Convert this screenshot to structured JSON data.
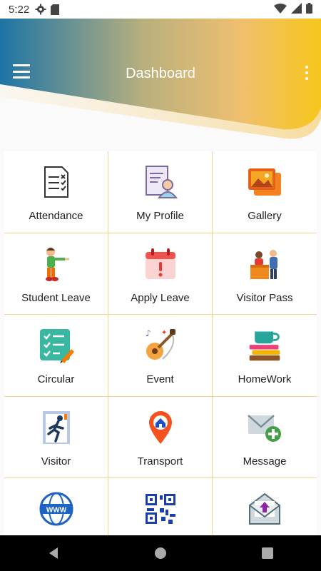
{
  "status_bar": {
    "time": "5:22",
    "icons": [
      "gear-icon",
      "sd-card-icon",
      "wifi-icon",
      "signal-icon",
      "battery-icon"
    ]
  },
  "header": {
    "title": "Dashboard",
    "menu_icon": "hamburger-menu-icon",
    "overflow_icon": "overflow-menu-icon",
    "gradient_colors": [
      "#1d74a6",
      "#f7c61c"
    ]
  },
  "tiles": [
    {
      "label": "Attendance",
      "icon": "attendance-icon"
    },
    {
      "label": "My Profile",
      "icon": "profile-icon"
    },
    {
      "label": "Gallery",
      "icon": "gallery-icon"
    },
    {
      "label": "Student Leave",
      "icon": "student-leave-icon"
    },
    {
      "label": "Apply Leave",
      "icon": "apply-leave-icon"
    },
    {
      "label": "Visitor Pass",
      "icon": "visitor-pass-icon"
    },
    {
      "label": "Circular",
      "icon": "circular-icon"
    },
    {
      "label": "Event",
      "icon": "event-icon"
    },
    {
      "label": "HomeWork",
      "icon": "homework-icon"
    },
    {
      "label": "Visitor",
      "icon": "visitor-icon"
    },
    {
      "label": "Transport",
      "icon": "transport-icon"
    },
    {
      "label": "Message",
      "icon": "message-icon"
    },
    {
      "label": "",
      "icon": "website-icon"
    },
    {
      "label": "",
      "icon": "qr-code-icon"
    },
    {
      "label": "",
      "icon": "inbox-upload-icon"
    }
  ],
  "nav_bar": {
    "icons": [
      "back-icon",
      "home-icon",
      "recents-icon"
    ]
  },
  "colors": {
    "grid_divider": "#f2d58a",
    "accent_blue": "#1d74a6",
    "accent_yellow": "#f7c61c"
  }
}
